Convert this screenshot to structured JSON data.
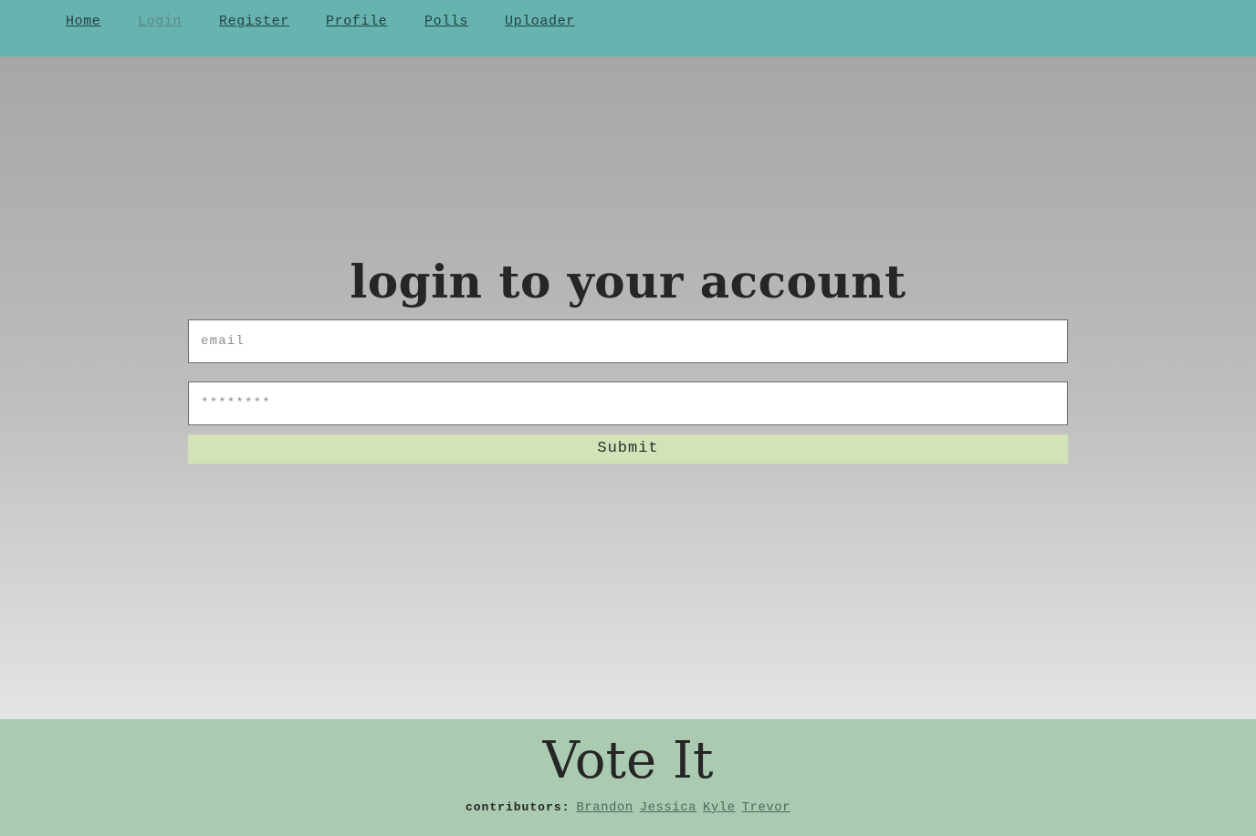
{
  "nav": {
    "items": [
      {
        "label": "Home"
      },
      {
        "label": "Login"
      },
      {
        "label": "Register"
      },
      {
        "label": "Profile"
      },
      {
        "label": "Polls"
      },
      {
        "label": "Uploader"
      }
    ],
    "active": "Login"
  },
  "login": {
    "heading": "login to your account",
    "email_placeholder": "email",
    "password_placeholder": "********",
    "submit_label": "Submit"
  },
  "footer": {
    "brand": "Vote It",
    "contributors_label": "contributors:",
    "contributors": [
      "Brandon",
      "Jessica",
      "Kyle",
      "Trevor"
    ]
  },
  "colors": {
    "navbar": "#66b3af",
    "footer": "#aacbb1",
    "submit": "#d3e3b8"
  }
}
